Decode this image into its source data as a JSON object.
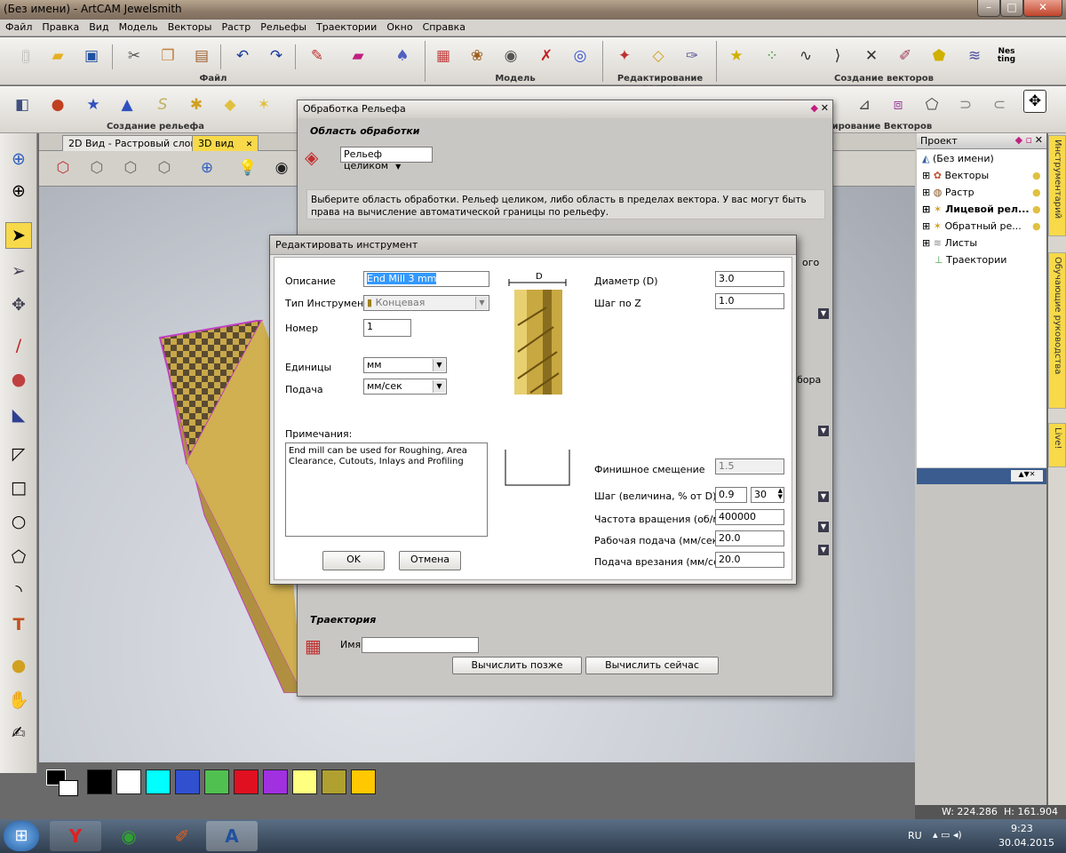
{
  "window": {
    "title": "(Без имени) - ArtCAM Jewelsmith",
    "min": "–",
    "max": "□",
    "close": "✕"
  },
  "menu": [
    "Файл",
    "Правка",
    "Вид",
    "Модель",
    "Векторы",
    "Растр",
    "Рельефы",
    "Траектории",
    "Окно",
    "Справка"
  ],
  "toolbar_groups": {
    "file": "Файл",
    "model": "Модель",
    "edit_raster": "Редактирование растра",
    "create_vectors": "Создание векторов",
    "create_relief": "Создание рельефа",
    "edit_vectors": "тирование Векторов"
  },
  "nesting_label": "Nes ting",
  "tabs": [
    {
      "label": "2D Вид - Растровый слой",
      "active": false
    },
    {
      "label": "3D вид",
      "active": true,
      "close": "✕"
    }
  ],
  "project": {
    "header": "Проект",
    "items": [
      {
        "label": "(Без имени)",
        "bold": false
      },
      {
        "label": "Векторы",
        "bold": false
      },
      {
        "label": "Растр",
        "bold": false
      },
      {
        "label": "Лицевой рел...",
        "bold": true
      },
      {
        "label": "Обратный ре...",
        "bold": false
      },
      {
        "label": "Листы",
        "bold": false
      },
      {
        "label": "Траектории",
        "bold": false
      }
    ]
  },
  "side_tabs": [
    "Инструментарий",
    "Обучающие руководства",
    "Live!"
  ],
  "status": {
    "w": "W: 224.286",
    "h": "H: 161.904"
  },
  "colors": [
    "#000000",
    "#ffffff",
    "#00ffff",
    "#3050d0",
    "#50c050",
    "#e01020",
    "#a030e0",
    "#ffff80",
    "#b0a030",
    "#ffc800"
  ],
  "relief_dialog": {
    "title": "Обработка Рельефа",
    "section_area": "Область обработки",
    "area_select": "Рельеф целиком",
    "info": "Выберите область обработки. Рельеф целиком, либо область в пределах вектора. У вас могут быть права на вычисление автоматической границы по рельефу.",
    "partial_right_1": "ого",
    "partial_right_2": "бора",
    "section_toolpath": "Траектория",
    "name_label": "Имя:",
    "name_value": "",
    "btn_later": "Вычислить позже",
    "btn_now": "Вычислить сейчас"
  },
  "tool_dialog": {
    "title": "Редактировать инструмент",
    "description_label": "Описание",
    "description_value": "End Mill 3 mm",
    "type_label": "Тип Инструмента",
    "type_value": "Концевая",
    "number_label": "Номер",
    "number_value": "1",
    "units_label": "Единицы",
    "units_value": "мм",
    "feed_label": "Подача",
    "feed_value": "мм/сек",
    "notes_label": "Примечания:",
    "notes_value": "End mill can be used for Roughing, Area Clearance, Cutouts, Inlays and Profiling",
    "d_label": "D",
    "diameter_label": "Диаметр (D)",
    "diameter_value": "3.0",
    "stepz_label": "Шаг по Z",
    "stepz_value": "1.0",
    "finish_label": "Финишное смещение",
    "finish_value": "1.5",
    "step_label": "Шаг (величина, % от D)",
    "step_value": "0.9",
    "step_percent": "30",
    "spindle_label": "Частота вращения (об/мин)",
    "spindle_value": "400000",
    "workfeed_label": "Рабочая подача (мм/сек)",
    "workfeed_value": "20.0",
    "plunge_label": "Подача врезания (мм/сек)",
    "plunge_value": "20.0",
    "ok": "OK",
    "cancel": "Отмена"
  },
  "taskbar": {
    "lang": "RU",
    "time": "9:23",
    "date": "30.04.2015"
  }
}
